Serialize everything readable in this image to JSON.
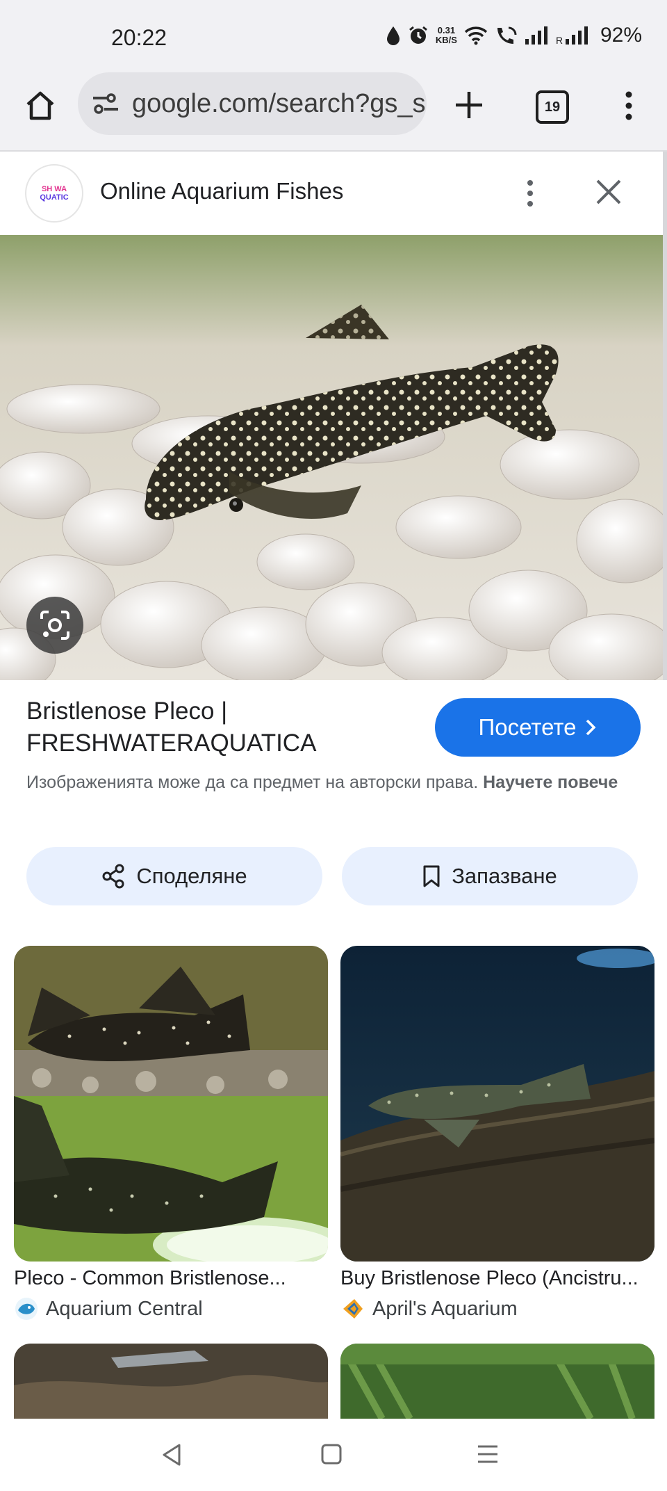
{
  "status_bar": {
    "time": "20:22",
    "net_speed_value": "0.31",
    "net_speed_unit": "KB/S",
    "battery": "92%",
    "icons": [
      "water-drop-icon",
      "alarm-icon",
      "wifi-icon",
      "wifi-call-icon",
      "signal-icon",
      "roaming-signal-icon"
    ]
  },
  "browser": {
    "url": "google.com/search?gs_s",
    "tab_count": "19",
    "icons": [
      "home-icon",
      "site-settings-icon",
      "new-tab-icon",
      "overflow-menu-icon"
    ]
  },
  "panel": {
    "logo_line1": "SH WA",
    "logo_line2": "QUATIC",
    "site_name": "Online Aquarium Fishes"
  },
  "result": {
    "title": "Bristlenose Pleco | FRESHWATERAQUATICA",
    "visit_label": "Посетете",
    "copyright_text": "Изображенията може да са предмет на авторски права.",
    "learn_more": "Научете повече",
    "share_label": "Споделяне",
    "save_label": "Запазване"
  },
  "related": [
    {
      "title": "Pleco - Common Bristlenose...",
      "source": "Aquarium Central"
    },
    {
      "title": "Buy Bristlenose Pleco (Ancistru...",
      "source": "April's Aquarium"
    }
  ],
  "colors": {
    "accent": "#1a73e8",
    "pill_bg": "#e8f0fe",
    "toolbar_bg": "#f1f1f4"
  }
}
